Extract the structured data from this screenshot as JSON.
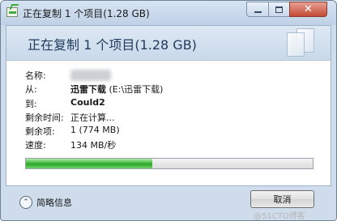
{
  "window": {
    "title": "正在复制 1 个项目(1.28 GB)",
    "controls": {
      "minimize": "",
      "maximize": "",
      "close": "✕"
    }
  },
  "header": {
    "title": "正在复制 1 个项目(1.28 GB)"
  },
  "details": {
    "name_label": "名称:",
    "from_label": "从:",
    "from_bold": "迅雷下载",
    "from_path": " (E:\\迅雷下载)",
    "to_label": "到:",
    "to_value": "Could2",
    "time_left_label": "剩余时间:",
    "time_left_value": "正在计算...",
    "items_left_label": "剩余项:",
    "items_left_value": "1 (774 MB)",
    "speed_label": "速度:",
    "speed_value": "134 MB/秒"
  },
  "progress": {
    "percent": 44
  },
  "footer": {
    "toggle_icon": "⌃",
    "details_label": "简略信息",
    "cancel_label": "取消",
    "watermark": "@51CTO博客"
  },
  "colors": {
    "progress_green": "#3fbb3a",
    "header_title": "#1e3a5c",
    "chrome_blue": "#cfdceb",
    "close_red": "#c44a36"
  }
}
